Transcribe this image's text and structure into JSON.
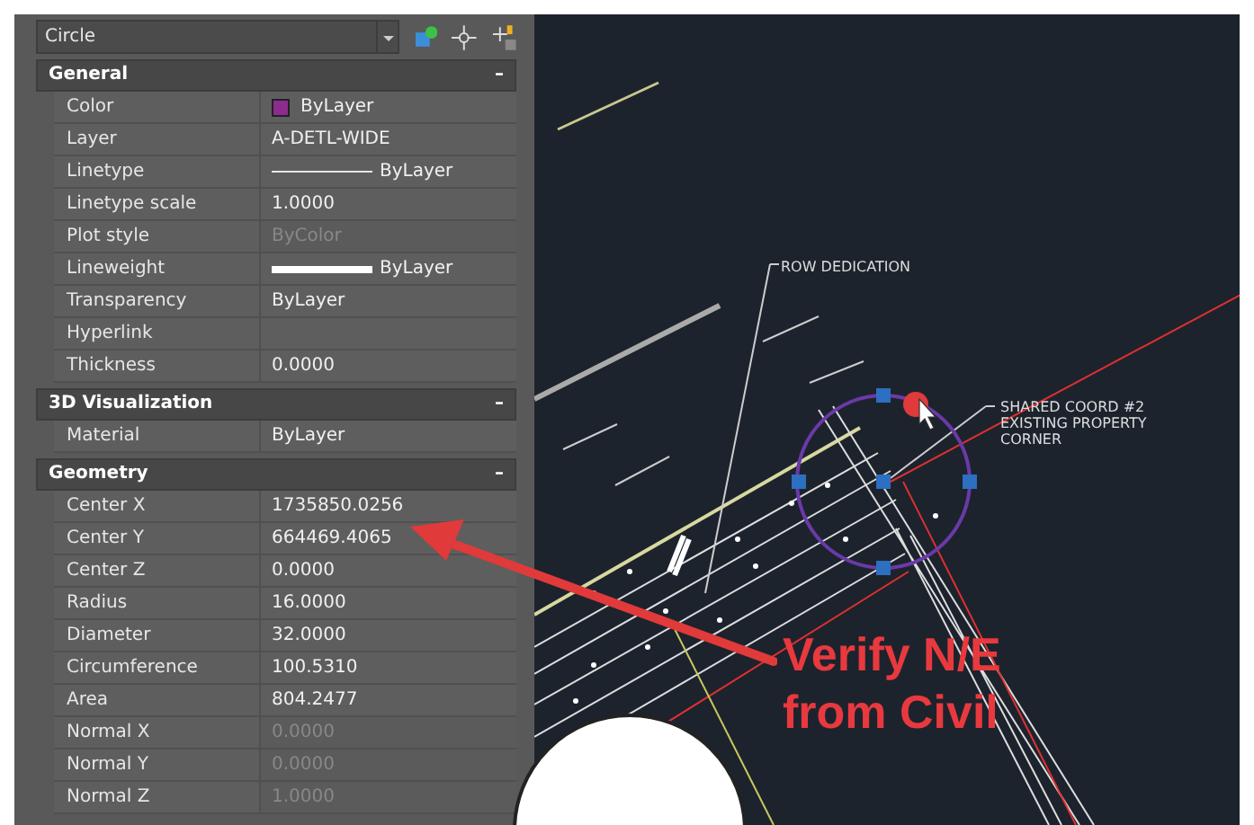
{
  "object_type": "Circle",
  "sections": [
    {
      "title": "General",
      "toggle": "–",
      "expanded": true,
      "rows": [
        {
          "label": "Color",
          "value": "ByLayer",
          "kind": "color",
          "color": "#8e2b8e",
          "disabled": false
        },
        {
          "label": "Layer",
          "value": "A-DETL-WIDE",
          "kind": "text",
          "disabled": false
        },
        {
          "label": "Linetype",
          "value": "ByLayer",
          "kind": "linetype",
          "disabled": false
        },
        {
          "label": "Linetype scale",
          "value": "1.0000",
          "kind": "text",
          "disabled": false
        },
        {
          "label": "Plot style",
          "value": "ByColor",
          "kind": "text",
          "disabled": true
        },
        {
          "label": "Lineweight",
          "value": "ByLayer",
          "kind": "lineweight",
          "disabled": false
        },
        {
          "label": "Transparency",
          "value": "ByLayer",
          "kind": "text",
          "disabled": false
        },
        {
          "label": "Hyperlink",
          "kind": "text"
        },
        {
          "label": "Thickness",
          "value": "0.0000",
          "kind": "text",
          "disabled": false
        }
      ]
    },
    {
      "title": "3D Visualization",
      "toggle": "–",
      "expanded": true,
      "rows": [
        {
          "label": "Material",
          "value": "ByLayer",
          "kind": "text",
          "disabled": false
        }
      ]
    },
    {
      "title": "Geometry",
      "toggle": "–",
      "expanded": true,
      "rows": [
        {
          "label": "Center X",
          "value": "1735850.0256",
          "kind": "text",
          "disabled": false
        },
        {
          "label": "Center Y",
          "value": "664469.4065",
          "kind": "text",
          "disabled": false
        },
        {
          "label": "Center Z",
          "value": "0.0000",
          "kind": "text",
          "disabled": false
        },
        {
          "label": "Radius",
          "value": "16.0000",
          "kind": "text",
          "disabled": false
        },
        {
          "label": "Diameter",
          "value": "32.0000",
          "kind": "text",
          "disabled": false
        },
        {
          "label": "Circumference",
          "value": "100.5310",
          "kind": "text",
          "disabled": false
        },
        {
          "label": "Area",
          "value": "804.2477",
          "kind": "text",
          "disabled": false
        },
        {
          "label": "Normal X",
          "value": "0.0000",
          "kind": "text",
          "disabled": true
        },
        {
          "label": "Normal Y",
          "value": "0.0000",
          "kind": "text",
          "disabled": true
        },
        {
          "label": "Normal Z",
          "value": "1.0000",
          "kind": "text",
          "disabled": true
        }
      ]
    }
  ],
  "drawing_labels": [
    {
      "text": "ROW DEDICATION"
    },
    {
      "text": "SHARED COORD #2\nEXISTING PROPERTY\nCORNER"
    }
  ],
  "callout": {
    "lines": [
      "Verify N/E",
      "from Civil"
    ]
  }
}
